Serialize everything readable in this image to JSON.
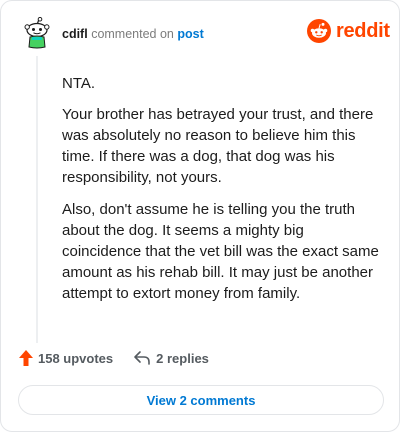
{
  "comment": {
    "username": "cdifl",
    "action_text": "commented on",
    "target_text": "post"
  },
  "brand": {
    "name": "reddit",
    "color": "#ff4500"
  },
  "body": {
    "paragraphs": [
      "NTA.",
      "Your brother has betrayed your trust, and there was absolutely no reason to believe him this time. If there was a dog, that dog was his responsibility, not yours.",
      "Also, don't assume he is telling you the truth about the dog. It seems a mighty big coincidence that the vet bill was the exact same amount as his rehab bill. It may just be another attempt to extort money from family."
    ]
  },
  "actions": {
    "upvotes_label": "158 upvotes",
    "replies_label": "2 replies",
    "upvote_icon": "upvote-arrow-icon",
    "reply_icon": "reply-arrow-icon",
    "upvote_color": "#ff4500"
  },
  "view_comments_label": "View 2 comments",
  "link_color": "#0079d3"
}
